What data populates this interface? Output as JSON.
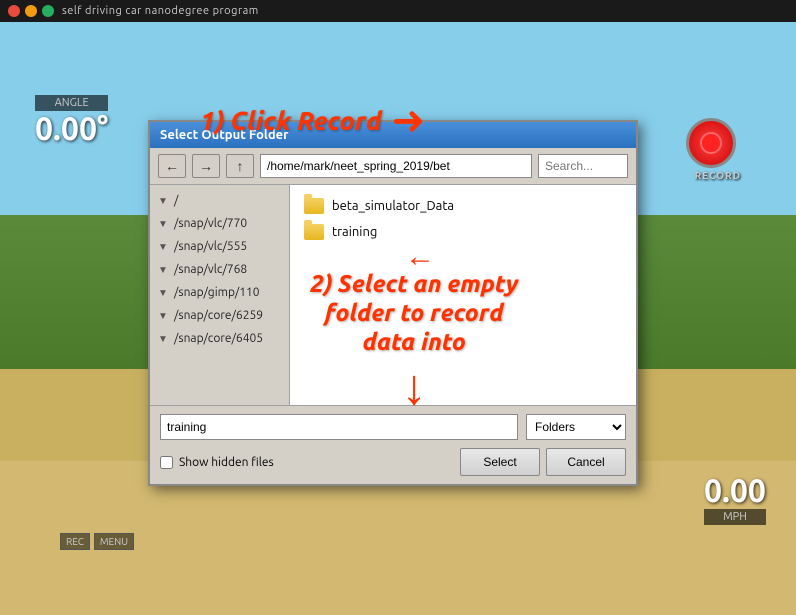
{
  "titlebar": {
    "text": "self  driving  car  nanodegree  program"
  },
  "angle": {
    "label": "ANGLE",
    "value": "0.00°"
  },
  "record": {
    "label": "RECORD"
  },
  "mph": {
    "value": "0.00",
    "label": "MPH"
  },
  "annotation1": {
    "text": "1) Click Record"
  },
  "annotation2": {
    "line1": "2) Select an empty",
    "line2": "folder to record",
    "line3": "data into"
  },
  "dialog": {
    "title": "Select Output Folder",
    "path": "/home/mark/neet_spring_2019/bet",
    "search_placeholder": "Search...",
    "sidebar_items": [
      {
        "label": "/"
      },
      {
        "label": "/snap/vlc/770"
      },
      {
        "label": "/snap/vlc/555"
      },
      {
        "label": "/snap/vlc/768"
      },
      {
        "label": "/snap/gimp/110"
      },
      {
        "label": "/snap/core/6259"
      },
      {
        "label": "/snap/core/6405"
      }
    ],
    "main_items": [
      {
        "label": "beta_simulator_Data"
      },
      {
        "label": "training"
      }
    ],
    "filename": "training",
    "filetype": "Folders",
    "show_hidden_label": "Show hidden files",
    "select_btn": "Select",
    "cancel_btn": "Cancel"
  },
  "rec_menu": {
    "rec": "REC",
    "menu": "MENU"
  }
}
